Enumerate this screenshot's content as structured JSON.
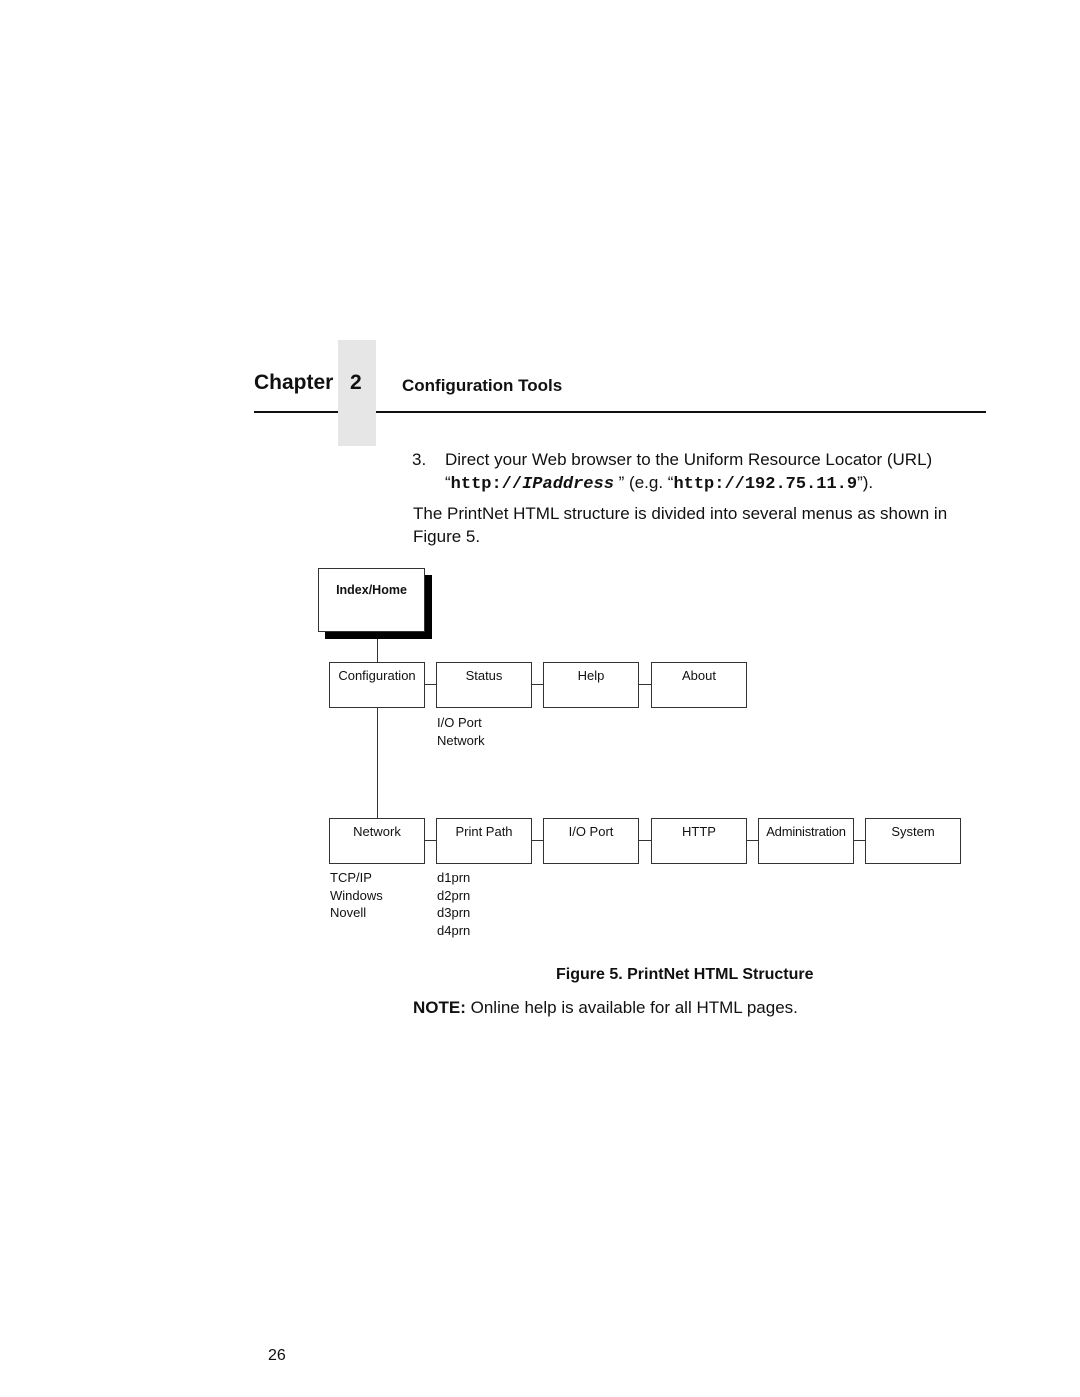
{
  "header": {
    "chapter_label": "Chapter",
    "chapter_number": "2",
    "chapter_title": "Configuration Tools"
  },
  "step": {
    "number": "3.",
    "text_before": "Direct your Web browser to the Uniform Resource Locator (URL) “",
    "url_prefix": "http://",
    "url_placeholder": "IPaddress",
    "text_middle": " ” (e.g. “",
    "url_example": "http://192.75.11.9",
    "text_after": "”)."
  },
  "intro": "The PrintNet HTML structure is divided into several menus as shown in Figure 5.",
  "figure": {
    "root": "Index/Home",
    "row1": [
      {
        "label": "Configuration"
      },
      {
        "label": "Status",
        "children": [
          "I/O Port",
          "Network"
        ]
      },
      {
        "label": "Help"
      },
      {
        "label": "About"
      }
    ],
    "row2": [
      {
        "label": "Network",
        "children": [
          "TCP/IP",
          "Windows",
          "Novell"
        ]
      },
      {
        "label": "Print Path",
        "children": [
          "d1prn",
          "d2prn",
          "d3prn",
          "d4prn"
        ]
      },
      {
        "label": "I/O Port"
      },
      {
        "label": "HTTP"
      },
      {
        "label": "Administration"
      },
      {
        "label": "System"
      }
    ],
    "caption": "Figure 5. PrintNet HTML Structure"
  },
  "note": {
    "label": "NOTE:",
    "text": " Online help is available for all HTML pages."
  },
  "page_number": "26"
}
